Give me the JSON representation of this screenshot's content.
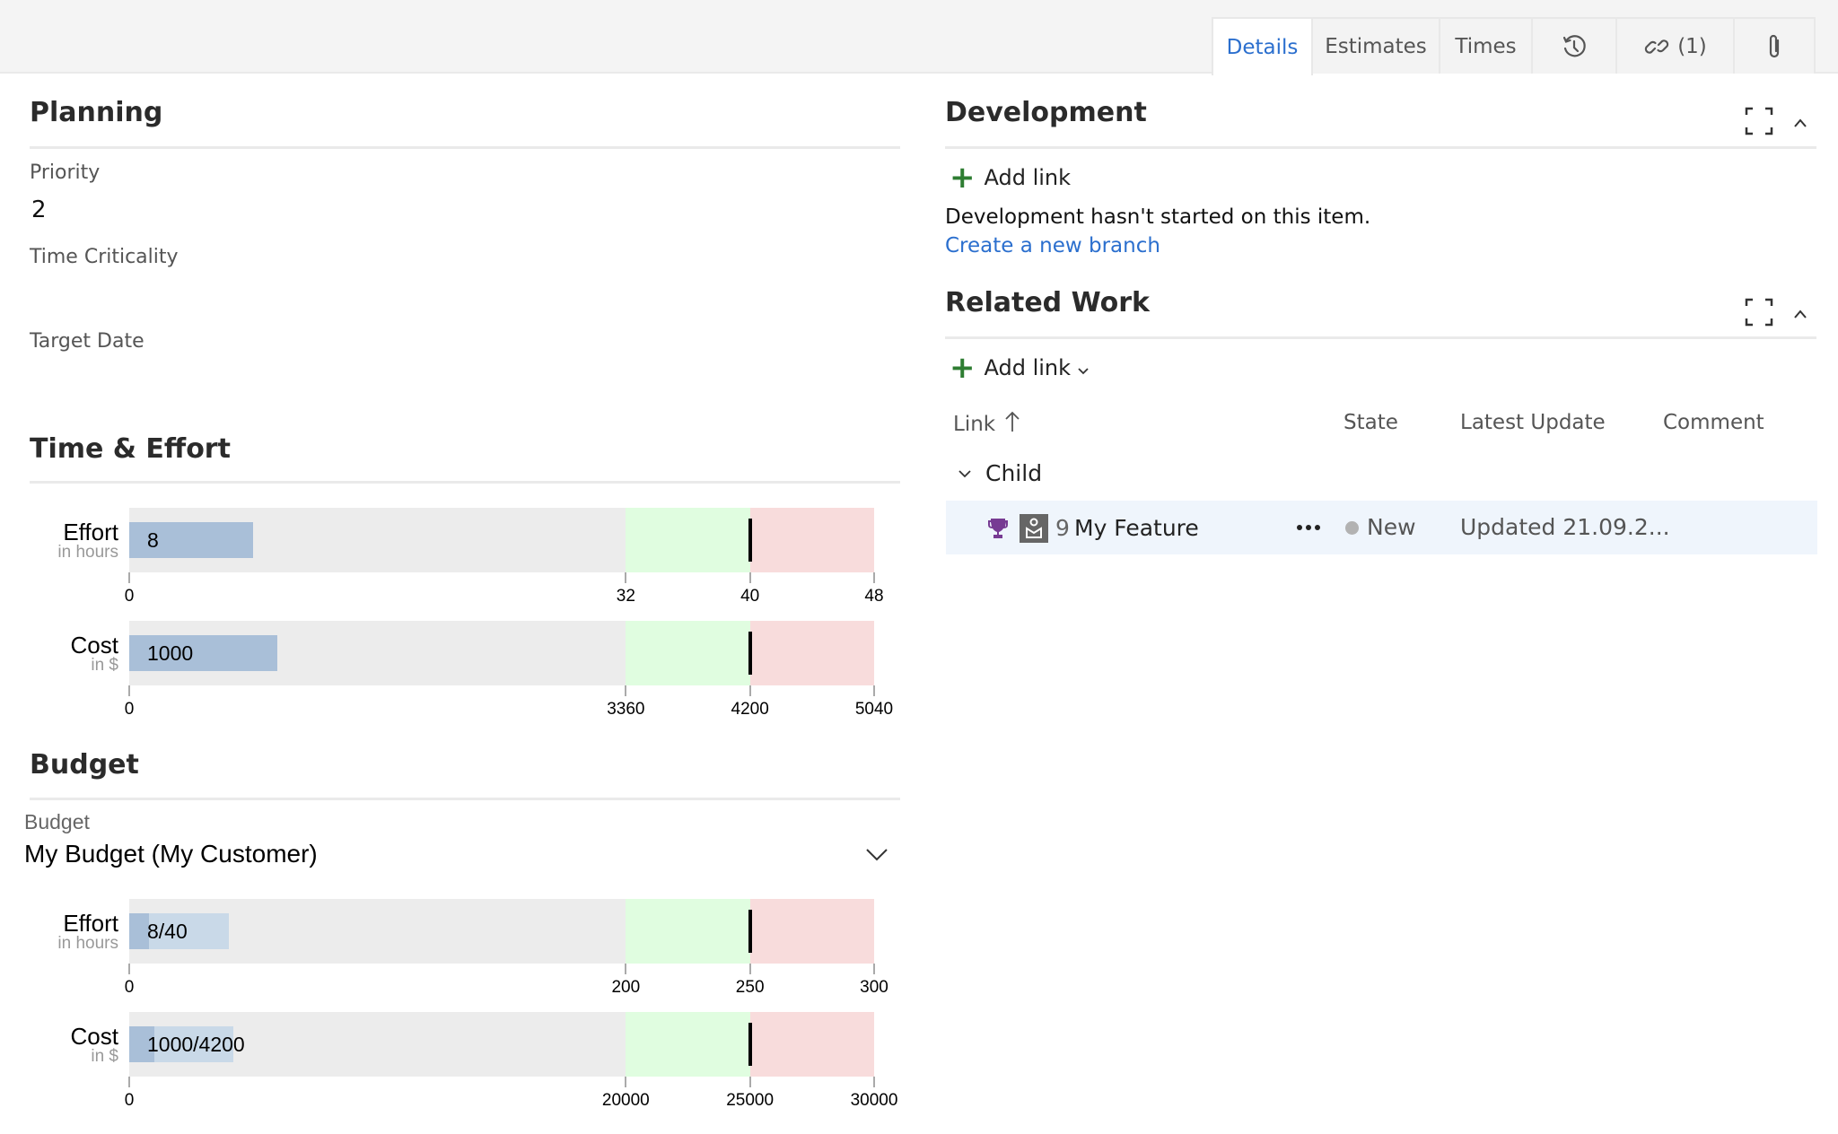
{
  "tabs": [
    {
      "label": "Details",
      "active": true
    },
    {
      "label": "Estimates",
      "active": false
    },
    {
      "label": "Times",
      "active": false
    },
    {
      "icon": "history-icon"
    },
    {
      "icon": "link-icon",
      "count": "(1)"
    },
    {
      "icon": "attachment-icon"
    }
  ],
  "planning": {
    "title": "Planning",
    "fields": [
      {
        "label": "Priority",
        "value": "2"
      },
      {
        "label": "Time Criticality",
        "value": ""
      },
      {
        "label": "Target Date",
        "value": ""
      }
    ]
  },
  "time_effort": {
    "title": "Time & Effort"
  },
  "budget": {
    "title": "Budget",
    "field_label": "Budget",
    "selected": "My Budget (My Customer)"
  },
  "colors": {
    "range_base": "#ececec",
    "range_good": "#e0fde0",
    "range_over": "#f8dcdc",
    "bar_actual": "#a9bfd8",
    "bar_budget": "#c9d9e8",
    "accent": "#2b6fce",
    "add_green": "#2e7d32",
    "feature_purple": "#773b93",
    "row_highlight": "#eff5fc"
  },
  "chart_data": [
    {
      "type": "bullet",
      "title": "Effort",
      "subtitle": "in hours",
      "value": 8,
      "value_label": "8",
      "ranges": [
        32,
        40,
        48
      ],
      "marker": 40,
      "ticks": [
        "0",
        "32",
        "40",
        "48"
      ],
      "tick_values": [
        0,
        32,
        40,
        48
      ],
      "xlim": [
        0,
        48
      ]
    },
    {
      "type": "bullet",
      "title": "Cost",
      "subtitle": "in $",
      "value": 1000,
      "value_label": "1000",
      "ranges": [
        3360,
        4200,
        5040
      ],
      "marker": 4200,
      "ticks": [
        "0",
        "3360",
        "4200",
        "5040"
      ],
      "tick_values": [
        0,
        3360,
        4200,
        5040
      ],
      "xlim": [
        0,
        5040
      ]
    },
    {
      "type": "bullet",
      "title": "Effort",
      "subtitle": "in hours",
      "value": 8,
      "budget_value": 40,
      "value_label": "8/40",
      "ranges": [
        200,
        250,
        300
      ],
      "marker": 250,
      "ticks": [
        "0",
        "200",
        "250",
        "300"
      ],
      "tick_values": [
        0,
        200,
        250,
        300
      ],
      "xlim": [
        0,
        300
      ]
    },
    {
      "type": "bullet",
      "title": "Cost",
      "subtitle": "in $",
      "value": 1000,
      "budget_value": 4200,
      "value_label": "1000/4200",
      "ranges": [
        20000,
        25000,
        30000
      ],
      "marker": 25000,
      "ticks": [
        "0",
        "20000",
        "25000",
        "30000"
      ],
      "tick_values": [
        0,
        20000,
        25000,
        30000
      ],
      "xlim": [
        0,
        30000
      ]
    }
  ],
  "development": {
    "title": "Development",
    "add_link": "Add link",
    "message": "Development hasn't started on this item.",
    "create_branch": "Create a new branch"
  },
  "related_work": {
    "title": "Related Work",
    "add_link": "Add link",
    "columns": [
      "Link",
      "State",
      "Latest Update",
      "Comment"
    ],
    "group": "Child",
    "rows": [
      {
        "id": "9",
        "title": "My Feature",
        "state": "New",
        "state_color": "#b2b2b2",
        "latest_update": "Updated 21.09.2...",
        "comment": ""
      }
    ]
  }
}
